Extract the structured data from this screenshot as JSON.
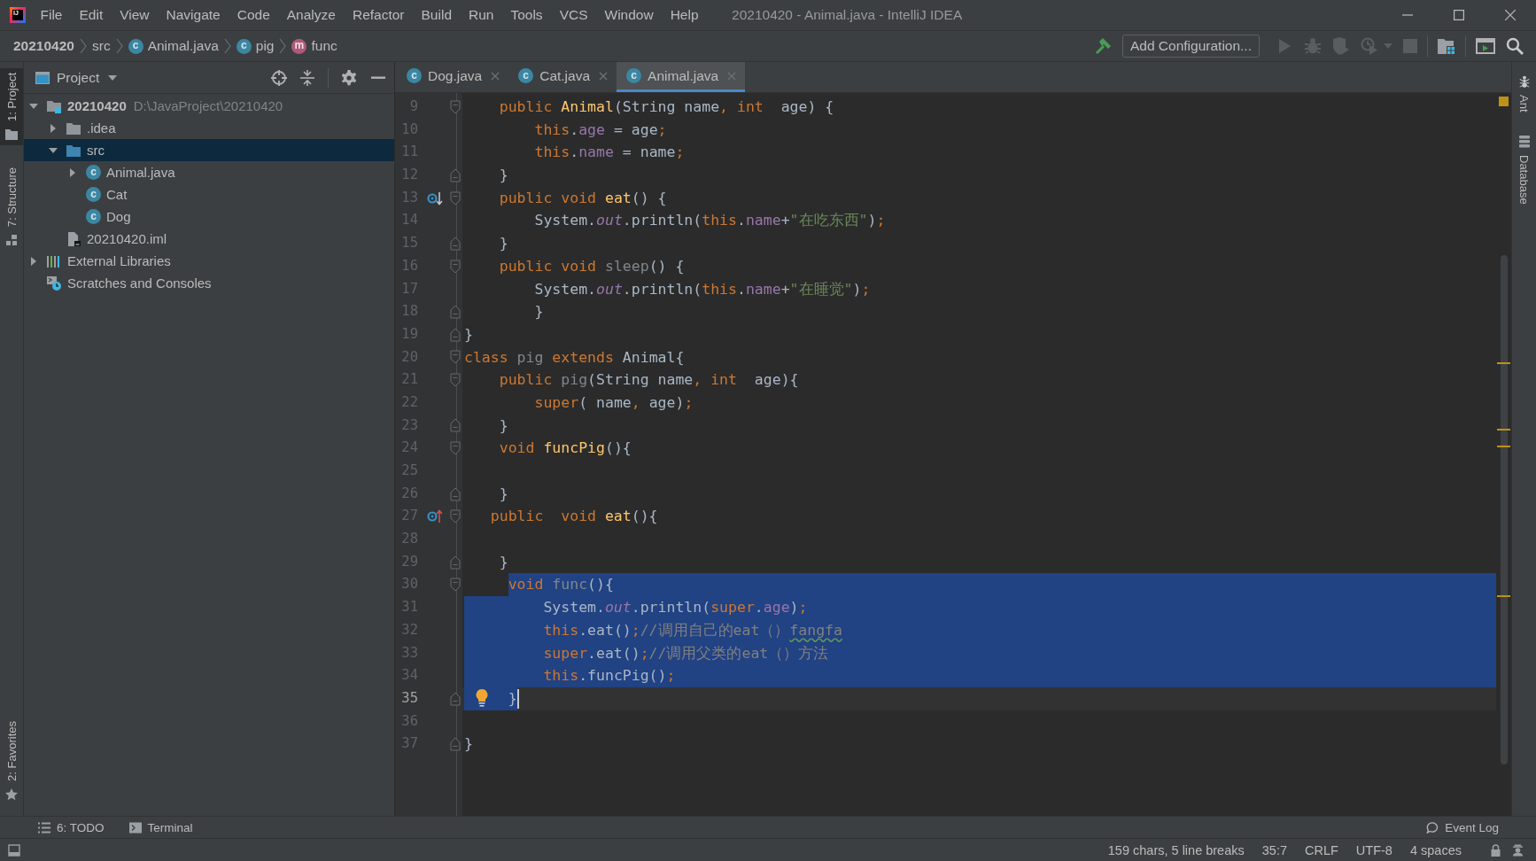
{
  "title_bar": {
    "logo_text": "IJ",
    "menu": [
      "File",
      "Edit",
      "View",
      "Navigate",
      "Code",
      "Analyze",
      "Refactor",
      "Build",
      "Run",
      "Tools",
      "VCS",
      "Window",
      "Help"
    ],
    "title": "20210420 - Animal.java - IntelliJ IDEA"
  },
  "nav_bar": {
    "breadcrumbs": [
      {
        "label": "20210420",
        "kind": "project"
      },
      {
        "label": "src",
        "kind": "folder"
      },
      {
        "label": "Animal.java",
        "kind": "class",
        "icon_letter": "c"
      },
      {
        "label": "pig",
        "kind": "class",
        "icon_letter": "c"
      },
      {
        "label": "func",
        "kind": "method",
        "icon_letter": "m"
      }
    ],
    "toolbar": [
      {
        "kind": "build",
        "disabled": false
      },
      {
        "kind": "configuration",
        "label": "Add Configuration..."
      },
      {
        "kind": "run",
        "disabled": true
      },
      {
        "kind": "debug",
        "disabled": true
      },
      {
        "kind": "coverage",
        "disabled": true
      },
      {
        "kind": "profile",
        "disabled": true
      },
      {
        "kind": "stop",
        "disabled": true
      },
      {
        "kind": "separator"
      },
      {
        "kind": "project-structure",
        "disabled": false
      },
      {
        "kind": "separator"
      },
      {
        "kind": "run-window",
        "disabled": false
      },
      {
        "kind": "search",
        "disabled": false
      }
    ]
  },
  "tool_strips": {
    "left_top": [
      {
        "label": "1: Project",
        "kind": "project",
        "selected": true
      },
      {
        "label": "7: Structure",
        "kind": "structure",
        "selected": false
      }
    ],
    "left_bottom": [
      {
        "label": "2: Favorites",
        "kind": "favorites",
        "selected": false
      }
    ],
    "right": [
      {
        "label": "Ant",
        "kind": "ant",
        "selected": false
      },
      {
        "label": "Database",
        "kind": "database",
        "selected": false
      }
    ]
  },
  "project_panel": {
    "title": "Project",
    "tree": [
      {
        "label": "20210420",
        "path": "D:\\JavaProject\\20210420",
        "kind": "module",
        "expanded": true,
        "selected": false,
        "children": [
          {
            "label": ".idea",
            "kind": "folder",
            "expanded": false,
            "selected": false
          },
          {
            "label": "src",
            "kind": "source-folder",
            "expanded": true,
            "selected": true,
            "children": [
              {
                "label": "Animal.java",
                "kind": "class",
                "icon_letter": "c",
                "expanded": false,
                "selected": false
              },
              {
                "label": "Cat",
                "kind": "class",
                "icon_letter": "c",
                "selected": false
              },
              {
                "label": "Dog",
                "kind": "class",
                "icon_letter": "c",
                "selected": false
              }
            ]
          },
          {
            "label": "20210420.iml",
            "kind": "iml",
            "selected": false
          }
        ]
      },
      {
        "label": "External Libraries",
        "kind": "libraries",
        "expanded": false,
        "selected": false
      },
      {
        "label": "Scratches and Consoles",
        "kind": "scratches",
        "selected": false
      }
    ]
  },
  "editor": {
    "tabs": [
      {
        "label": "Dog.java",
        "icon_letter": "c",
        "selected": false
      },
      {
        "label": "Cat.java",
        "icon_letter": "c",
        "selected": false
      },
      {
        "label": "Animal.java",
        "icon_letter": "c",
        "selected": true
      }
    ],
    "lines": [
      {
        "number": "9",
        "fold_open": true,
        "selected": false,
        "tokens": [
          {
            "kind": "kw",
            "text": "    public "
          },
          {
            "kind": "decl",
            "text": "Animal"
          },
          {
            "kind": "plain",
            "text": "(String name"
          },
          {
            "kind": "punct",
            "text": ", "
          },
          {
            "kind": "kw",
            "text": "int"
          },
          {
            "kind": "plain",
            "text": "  age) {"
          }
        ]
      },
      {
        "number": "10",
        "selected": false,
        "tokens": [
          {
            "kind": "kw",
            "text": "        this"
          },
          {
            "kind": "plain",
            "text": "."
          },
          {
            "kind": "field",
            "text": "age"
          },
          {
            "kind": "plain",
            "text": " = age"
          },
          {
            "kind": "punct",
            "text": ";"
          }
        ]
      },
      {
        "number": "11",
        "selected": false,
        "tokens": [
          {
            "kind": "kw",
            "text": "        this"
          },
          {
            "kind": "plain",
            "text": "."
          },
          {
            "kind": "field",
            "text": "name"
          },
          {
            "kind": "plain",
            "text": " = name"
          },
          {
            "kind": "punct",
            "text": ";"
          }
        ]
      },
      {
        "number": "12",
        "fold_close": true,
        "selected": false,
        "tokens": [
          {
            "kind": "plain",
            "text": "    }"
          }
        ]
      },
      {
        "number": "13",
        "fold_open": true,
        "overridden": true,
        "selected": false,
        "tokens": [
          {
            "kind": "kw",
            "text": "    public void "
          },
          {
            "kind": "decl",
            "text": "eat"
          },
          {
            "kind": "plain",
            "text": "() {"
          }
        ]
      },
      {
        "number": "14",
        "selected": false,
        "tokens": [
          {
            "kind": "plain",
            "text": "        System."
          },
          {
            "kind": "static",
            "text": "out"
          },
          {
            "kind": "plain",
            "text": ".println("
          },
          {
            "kind": "kw",
            "text": "this"
          },
          {
            "kind": "plain",
            "text": "."
          },
          {
            "kind": "field",
            "text": "name"
          },
          {
            "kind": "plain",
            "text": "+"
          },
          {
            "kind": "string",
            "text": "\"在吃东西\""
          },
          {
            "kind": "plain",
            "text": ")"
          },
          {
            "kind": "punct",
            "text": ";"
          }
        ]
      },
      {
        "number": "15",
        "fold_close": true,
        "selected": false,
        "tokens": [
          {
            "kind": "plain",
            "text": "    }"
          }
        ]
      },
      {
        "number": "16",
        "fold_open": true,
        "selected": false,
        "tokens": [
          {
            "kind": "kw",
            "text": "    public void "
          },
          {
            "kind": "unused",
            "text": "sleep"
          },
          {
            "kind": "plain",
            "text": "() {"
          }
        ]
      },
      {
        "number": "17",
        "selected": false,
        "tokens": [
          {
            "kind": "plain",
            "text": "        System."
          },
          {
            "kind": "static",
            "text": "out"
          },
          {
            "kind": "plain",
            "text": ".println("
          },
          {
            "kind": "kw",
            "text": "this"
          },
          {
            "kind": "plain",
            "text": "."
          },
          {
            "kind": "field",
            "text": "name"
          },
          {
            "kind": "plain",
            "text": "+"
          },
          {
            "kind": "string",
            "text": "\"在睡觉\""
          },
          {
            "kind": "plain",
            "text": ")"
          },
          {
            "kind": "punct",
            "text": ";"
          }
        ]
      },
      {
        "number": "18",
        "fold_close": true,
        "selected": false,
        "tokens": [
          {
            "kind": "plain",
            "text": "        }"
          }
        ]
      },
      {
        "number": "19",
        "fold_close": true,
        "selected": false,
        "tokens": [
          {
            "kind": "plain",
            "text": "}"
          }
        ]
      },
      {
        "number": "20",
        "fold_open": true,
        "selected": false,
        "tokens": [
          {
            "kind": "kw",
            "text": "class "
          },
          {
            "kind": "unused",
            "text": "pig"
          },
          {
            "kind": "kw",
            "text": " extends "
          },
          {
            "kind": "plain",
            "text": "Animal{"
          }
        ]
      },
      {
        "number": "21",
        "fold_open": true,
        "selected": false,
        "tokens": [
          {
            "kind": "kw",
            "text": "    public "
          },
          {
            "kind": "unused",
            "text": "pig"
          },
          {
            "kind": "plain",
            "text": "(String name"
          },
          {
            "kind": "punct",
            "text": ", "
          },
          {
            "kind": "kw",
            "text": "int"
          },
          {
            "kind": "plain",
            "text": "  age){"
          }
        ]
      },
      {
        "number": "22",
        "selected": false,
        "tokens": [
          {
            "kind": "kw",
            "text": "        super"
          },
          {
            "kind": "plain",
            "text": "( name"
          },
          {
            "kind": "punct",
            "text": ", "
          },
          {
            "kind": "plain",
            "text": "age)"
          },
          {
            "kind": "punct",
            "text": ";"
          }
        ]
      },
      {
        "number": "23",
        "fold_close": true,
        "selected": false,
        "tokens": [
          {
            "kind": "plain",
            "text": "    }"
          }
        ]
      },
      {
        "number": "24",
        "fold_open": true,
        "selected": false,
        "tokens": [
          {
            "kind": "kw",
            "text": "    void "
          },
          {
            "kind": "decl",
            "text": "funcPig"
          },
          {
            "kind": "plain",
            "text": "(){"
          }
        ]
      },
      {
        "number": "25",
        "selected": false
      },
      {
        "number": "26",
        "fold_close": true,
        "selected": false,
        "tokens": [
          {
            "kind": "plain",
            "text": "    }"
          }
        ]
      },
      {
        "number": "27",
        "fold_open": true,
        "overrides": true,
        "selected": false,
        "tokens": [
          {
            "kind": "kw",
            "text": "   public  void "
          },
          {
            "kind": "decl",
            "text": "eat"
          },
          {
            "kind": "plain",
            "text": "(){"
          }
        ]
      },
      {
        "number": "28",
        "selected": false
      },
      {
        "number": "29",
        "fold_close": true,
        "selected": false,
        "tokens": [
          {
            "kind": "plain",
            "text": "    }"
          }
        ]
      },
      {
        "number": "30",
        "fold_open": true,
        "selected": true,
        "tokens": [
          {
            "kind": "kw",
            "text": "     void "
          },
          {
            "kind": "unused",
            "text": "func"
          },
          {
            "kind": "plain",
            "text": "(){"
          }
        ]
      },
      {
        "number": "31",
        "selected": true,
        "tokens": [
          {
            "kind": "plain",
            "text": "         System."
          },
          {
            "kind": "static",
            "text": "out"
          },
          {
            "kind": "plain",
            "text": ".println("
          },
          {
            "kind": "kw",
            "text": "super"
          },
          {
            "kind": "plain",
            "text": "."
          },
          {
            "kind": "field",
            "text": "age"
          },
          {
            "kind": "plain",
            "text": ")"
          },
          {
            "kind": "punct",
            "text": ";"
          }
        ]
      },
      {
        "number": "32",
        "selected": true,
        "tokens": [
          {
            "kind": "kw",
            "text": "         this"
          },
          {
            "kind": "plain",
            "text": ".eat()"
          },
          {
            "kind": "punct",
            "text": ";"
          },
          {
            "kind": "comment",
            "text": "//调用自己的eat（）"
          },
          {
            "kind": "typo",
            "text": "fangfa"
          }
        ]
      },
      {
        "number": "33",
        "selected": true,
        "tokens": [
          {
            "kind": "kw",
            "text": "         super"
          },
          {
            "kind": "plain",
            "text": ".eat()"
          },
          {
            "kind": "punct",
            "text": ";"
          },
          {
            "kind": "comment",
            "text": "//调用父类的eat（）方法"
          }
        ]
      },
      {
        "number": "34",
        "selected": true,
        "tokens": [
          {
            "kind": "kw",
            "text": "         this"
          },
          {
            "kind": "plain",
            "text": ".funcPig()"
          },
          {
            "kind": "punct",
            "text": ";"
          }
        ]
      },
      {
        "number": "35",
        "fold_close": true,
        "selected": true,
        "caret": true,
        "bulb": true,
        "tokens": [
          {
            "kind": "plain",
            "text": "     }"
          }
        ]
      },
      {
        "number": "36",
        "selected": false
      },
      {
        "number": "37",
        "fold_close": true,
        "selected": false,
        "tokens": [
          {
            "kind": "plain",
            "text": "}"
          }
        ]
      }
    ]
  },
  "bottom_bar": {
    "left": [
      {
        "label": "6: TODO",
        "kind": "todo"
      },
      {
        "label": "Terminal",
        "kind": "terminal"
      }
    ],
    "right": [
      {
        "label": "Event Log",
        "kind": "event-log"
      }
    ]
  },
  "status_bar": {
    "items": [
      "159 chars, 5 line breaks",
      "35:7",
      "CRLF",
      "UTF-8",
      "4 spaces"
    ]
  }
}
